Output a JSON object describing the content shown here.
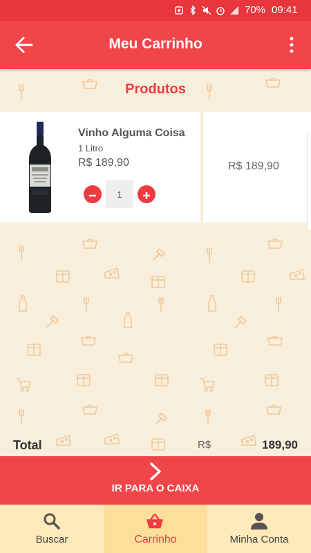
{
  "status_bar": {
    "battery": "70%",
    "time": "09:41",
    "icons": [
      "notification-icon",
      "bluetooth-icon",
      "mute-icon",
      "alarm-icon",
      "signal-icon",
      "battery-icon"
    ]
  },
  "app_bar": {
    "title": "Meu Carrinho",
    "back_icon": "arrow-left-icon",
    "menu_icon": "more-vert-icon"
  },
  "section": {
    "title": "Produtos"
  },
  "cart": {
    "items": [
      {
        "name": "Vinho Alguma Coisa",
        "volume": "1 Litro",
        "price": "R$ 189,90",
        "quantity": "1",
        "subtotal": "R$ 189,90"
      }
    ]
  },
  "total": {
    "label": "Total",
    "currency": "R$",
    "value": "189,90"
  },
  "checkout": {
    "label": "IR PARA O CAIXA",
    "icon": "chevron-right-icon"
  },
  "bottom_nav": {
    "tabs": [
      {
        "label": "Buscar",
        "icon": "search-icon"
      },
      {
        "label": "Carrinho",
        "icon": "basket-icon"
      },
      {
        "label": "Minha Conta",
        "icon": "person-icon"
      }
    ],
    "active": "Carrinho"
  },
  "colors": {
    "primary": "#f04549",
    "accent_text": "#ee3b41",
    "background": "#f7eedc",
    "nav_background": "#fde9b9"
  }
}
